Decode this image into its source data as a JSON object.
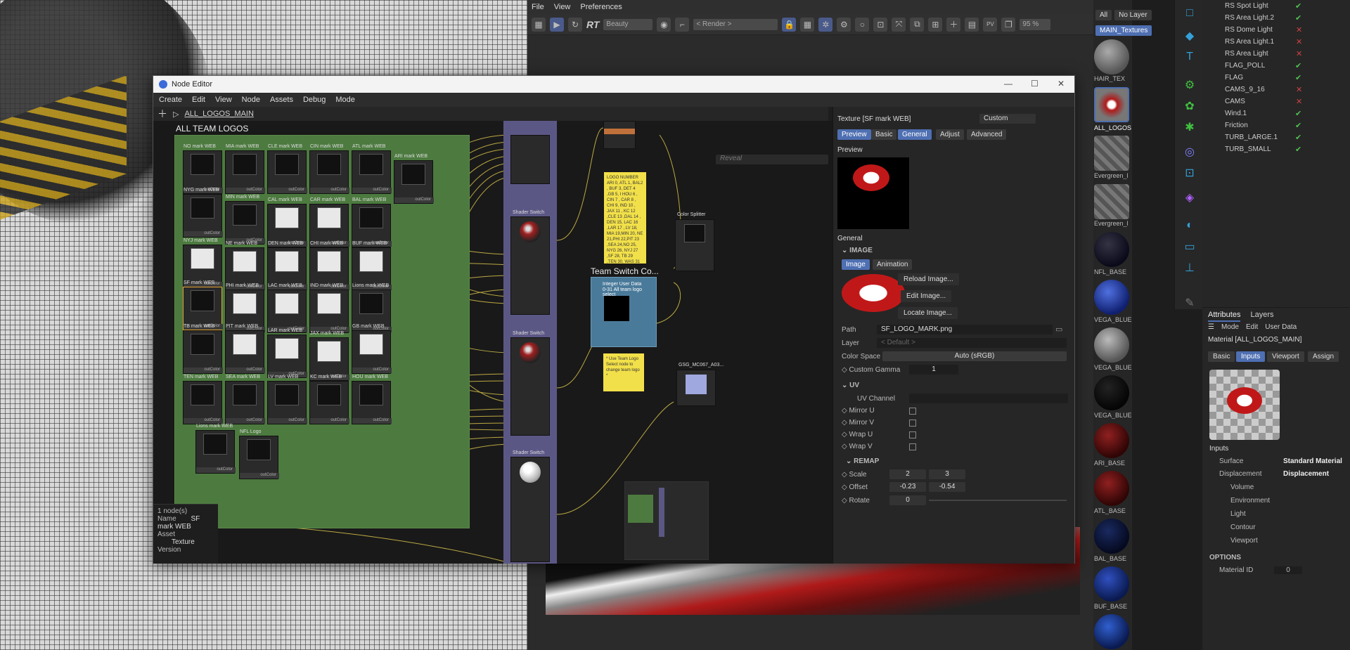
{
  "render_view": {
    "menu": [
      "File",
      "View",
      "Preferences"
    ],
    "toolbar": {
      "rt_label": "RT",
      "pass": "Beauty",
      "camera": "< Render >",
      "zoom": "95 %"
    }
  },
  "asset_browser": {
    "filter_all": "All",
    "filter_layer": "No Layer",
    "active_group": "MAIN_Textures",
    "materials": [
      "HAIR_TEX",
      "ALL_LOGOS",
      "Evergreen_l",
      "Evergreen_l",
      "NFL_BASE",
      "VEGA_BLUE",
      "VEGA_BLUE",
      "VEGA_BLUE",
      "ARI_BASE",
      "ATL_BASE",
      "BAL_BASE",
      "BUF_BASE"
    ]
  },
  "object_manager": {
    "objects": [
      {
        "name": "RS Spot Light",
        "state": "check"
      },
      {
        "name": "RS Area Light.2",
        "state": "check"
      },
      {
        "name": "RS Dome Light",
        "state": "x"
      },
      {
        "name": "RS Area Light.1",
        "state": "x"
      },
      {
        "name": "RS Area Light",
        "state": "x"
      },
      {
        "name": "FLAG_POLL",
        "state": "check"
      },
      {
        "name": "FLAG",
        "state": "check"
      },
      {
        "name": "CAMS_9_16",
        "state": "x"
      },
      {
        "name": "CAMS",
        "state": "x"
      },
      {
        "name": "Wind.1",
        "state": "check"
      },
      {
        "name": "Friction",
        "state": "check"
      },
      {
        "name": "TURB_LARGE.1",
        "state": "check"
      },
      {
        "name": "TURB_SMALL",
        "state": "check"
      }
    ]
  },
  "attributes": {
    "tabs": [
      "Attributes",
      "Layers"
    ],
    "menu": [
      "Mode",
      "Edit",
      "User Data"
    ],
    "material_title": "Material [ALL_LOGOS_MAIN]",
    "buttons": [
      "Basic",
      "Inputs",
      "Viewport",
      "Assign"
    ],
    "inputs_header": "Inputs",
    "inputs": [
      {
        "label": "Surface",
        "value": "Standard Material"
      },
      {
        "label": "Displacement",
        "value": "Displacement"
      },
      {
        "label": "Volume",
        "value": ""
      },
      {
        "label": "Environment",
        "value": ""
      },
      {
        "label": "Light",
        "value": ""
      },
      {
        "label": "Contour",
        "value": ""
      },
      {
        "label": "Viewport",
        "value": ""
      }
    ],
    "options_header": "OPTIONS",
    "material_id_label": "Material ID",
    "material_id_value": "0"
  },
  "node_editor": {
    "title": "Node Editor",
    "menu": [
      "Create",
      "Edit",
      "View",
      "Node",
      "Assets",
      "Debug",
      "Mode"
    ],
    "breadcrumb": "ALL_LOGOS_MAIN",
    "reveal_placeholder": "Reveal",
    "group_title": "ALL TEAM LOGOS",
    "texture_nodes": [
      "NO mark WEB",
      "MIA mark WEB",
      "CLE mark WEB",
      "CIN mark WEB",
      "ATL mark WEB",
      "ARI mark WEB",
      "NYG mark WEB",
      "MIN mark WEB",
      "CAL mark WEB",
      "CAR mark WEB",
      "BAL mark WEB",
      "NYJ mark WEB",
      "NE mark WEB",
      "DEN mark WEB",
      "CHI mark WEB",
      "BUF mark WEB",
      "SF mark WEB",
      "PHI mark WEB",
      "LAC mark WEB",
      "IND mark WEB",
      "Lions mark WEB",
      "TB mark WEB",
      "PIT mark WEB",
      "LAR mark WEB",
      "JAX mark WEB",
      "GB mark WEB",
      "TEN mark WEB",
      "SEA mark WEB",
      "LV mark WEB",
      "KC mark WEB",
      "HOU mark WEB",
      "Lions mark WEB",
      "NFL Logo"
    ],
    "shader_switch_label": "Shader Switch",
    "color_splitter_label": "Color Splitter",
    "team_switch_title": "Team Switch Co...",
    "team_switch_node": "Integer User Data",
    "team_switch_sub": "0-31 All team logo select",
    "note_numbers": "LOGO NUMBER\nARI 0, ATL 1, BAL2 , BUF 3, DET 4 ,GB 5, I HOU 6 , CIN 7 , CAR 8 , CHI 9, IND 10 , JAX 11 , KC 12 ,CLE 13 ,DAL 14 , DEN 15, LAC 16 ,LAR 17 , LV 18, MIA 19,MIN 20, NE 21,PHI 22,PIT 23 ,SEA 24,NO 25, NYG 26, NYJ 27 ,SF 28, TB 29 ,TEN 30, WAS 31",
    "note_hint": "* Use Team Logo Select node to change team logo *",
    "extra_texture": "GSG_MC067_A03...",
    "info": {
      "count": "1 node(s)",
      "name_label": "Name",
      "name_value": "SF mark WEB",
      "asset_label": "Asset",
      "asset_value": "Texture",
      "version_label": "Version"
    },
    "props": {
      "header": "Texture [SF mark WEB]",
      "mode": "Custom",
      "tabs": [
        "Preview",
        "Basic",
        "General",
        "Adjust",
        "Advanced"
      ],
      "preview_label": "Preview",
      "general_label": "General",
      "image_section": "IMAGE",
      "image_tabs": [
        "Image",
        "Animation"
      ],
      "reload": "Reload Image...",
      "edit": "Edit Image...",
      "locate": "Locate Image...",
      "path_label": "Path",
      "path_value": "SF_LOGO_MARK.png",
      "layer_label": "Layer",
      "layer_value": "< Default >",
      "colorspace_label": "Color Space",
      "colorspace_value": "Auto (sRGB)",
      "gamma_label": "Custom Gamma",
      "gamma_value": "1",
      "uv_section": "UV",
      "uv_channel": "UV Channel",
      "mirror_u": "Mirror U",
      "mirror_v": "Mirror V",
      "wrap_u": "Wrap U",
      "wrap_v": "Wrap V",
      "remap_section": "REMAP",
      "scale_label": "Scale",
      "scale_x": "2",
      "scale_y": "3",
      "offset_label": "Offset",
      "offset_x": "-0.23",
      "offset_y": "-0.54",
      "rotate_label": "Rotate",
      "rotate_value": "0"
    }
  },
  "colors": {
    "accent": "#4e6fb2",
    "group_green": "#4c7a3f",
    "shader_purple": "#5b5785",
    "note_yellow": "#f2e04a",
    "wire": "#d8c24a"
  }
}
